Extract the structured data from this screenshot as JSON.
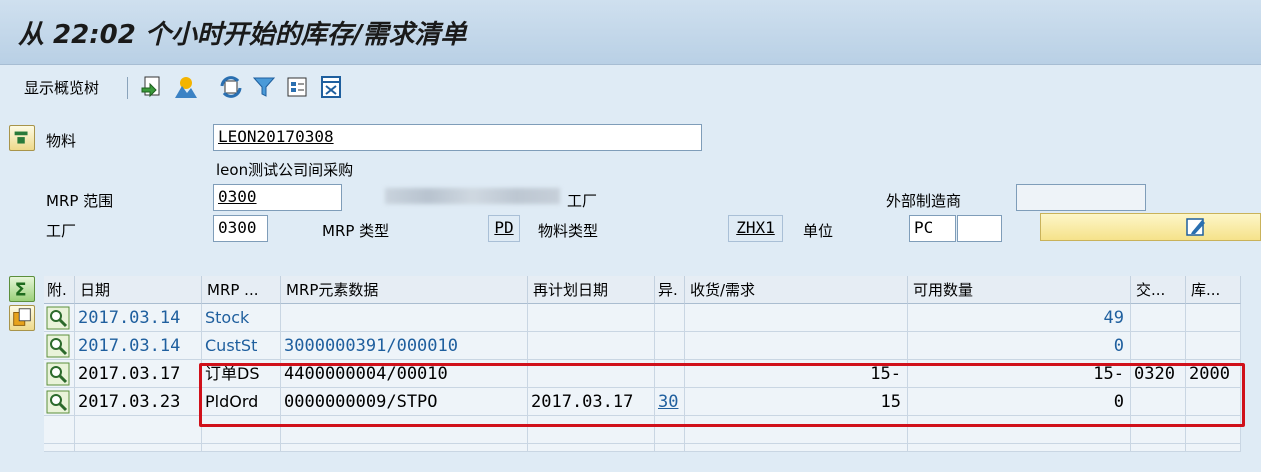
{
  "title": "从 22:02 个小时开始的库存/需求清单",
  "toolbar": {
    "show_tree": "显示概览树",
    "icons": [
      "save-icon",
      "graphic-icon",
      "refresh-icon",
      "filter-icon",
      "details-icon",
      "layout-icon"
    ]
  },
  "header": {
    "material_label": "物料",
    "material_value": "LEON20170308",
    "material_desc": "leon测试公司间采购",
    "mrp_area_label": "MRP 范围",
    "mrp_area_value": "0300",
    "plant_suffix": "工厂",
    "ext_mfr_label": "外部制造商",
    "ext_mfr_value": "",
    "plant_label": "工厂",
    "plant_value": "0300",
    "mrp_type_label": "MRP 类型",
    "mrp_type_value": "PD",
    "mat_type_label": "物料类型",
    "mat_type_value": "ZHX1",
    "unit_label": "单位",
    "unit_value": "PC",
    "unit_extra": ""
  },
  "grid": {
    "columns": [
      "附.",
      "日期",
      "MRP ...",
      "MRP元素数据",
      "再计划日期",
      "异.",
      "收货/需求",
      "可用数量",
      "交...",
      "库..."
    ],
    "rows": [
      {
        "date": "2017.03.14",
        "mrp": "Stock",
        "data": "",
        "resched": "",
        "exc": "",
        "qty": "",
        "avail": "49",
        "sup": "",
        "stor": "",
        "style": "blue"
      },
      {
        "date": "2017.03.14",
        "mrp": "CustSt",
        "data": "3000000391/000010",
        "resched": "",
        "exc": "",
        "qty": "",
        "avail": "0",
        "sup": "",
        "stor": "",
        "style": "blue"
      },
      {
        "date": "2017.03.17",
        "mrp": "订单DS",
        "data": "4400000004/00010",
        "resched": "",
        "exc": "",
        "qty": "15-",
        "avail": "15-",
        "sup": "0320",
        "stor": "2000",
        "style": "black"
      },
      {
        "date": "2017.03.23",
        "mrp": "PldOrd",
        "data": "0000000009/STPO",
        "resched": "2017.03.17",
        "exc": "30",
        "qty": "15",
        "avail": "0",
        "sup": "",
        "stor": "",
        "style": "black"
      }
    ]
  },
  "colors": {
    "highlight": "#d0101a",
    "link": "#1f5f9e"
  }
}
